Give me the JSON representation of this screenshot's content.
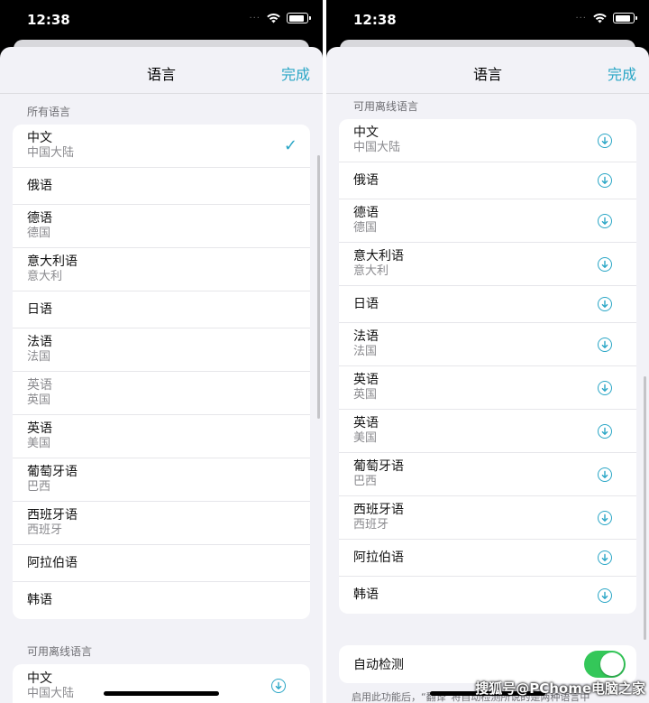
{
  "status": {
    "time": "12:38",
    "dots": "···"
  },
  "nav": {
    "title": "语言",
    "done": "完成"
  },
  "left": {
    "all_languages_header": "所有语言",
    "all_languages": [
      {
        "name": "中文",
        "region": "中国大陆",
        "selected": true
      },
      {
        "name": "俄语",
        "region": ""
      },
      {
        "name": "德语",
        "region": "德国"
      },
      {
        "name": "意大利语",
        "region": "意大利"
      },
      {
        "name": "日语",
        "region": ""
      },
      {
        "name": "法语",
        "region": "法国"
      },
      {
        "name": "英语",
        "region": "英国",
        "dimmed": true
      },
      {
        "name": "英语",
        "region": "美国"
      },
      {
        "name": "葡萄牙语",
        "region": "巴西"
      },
      {
        "name": "西班牙语",
        "region": "西班牙"
      },
      {
        "name": "阿拉伯语",
        "region": ""
      },
      {
        "name": "韩语",
        "region": ""
      }
    ],
    "offline_header": "可用离线语言",
    "offline_first": {
      "name": "中文",
      "region": "中国大陆"
    }
  },
  "right": {
    "offline_header": "可用离线语言",
    "offline_languages": [
      {
        "name": "中文",
        "region": "中国大陆"
      },
      {
        "name": "俄语",
        "region": ""
      },
      {
        "name": "德语",
        "region": "德国"
      },
      {
        "name": "意大利语",
        "region": "意大利"
      },
      {
        "name": "日语",
        "region": ""
      },
      {
        "name": "法语",
        "region": "法国"
      },
      {
        "name": "英语",
        "region": "英国"
      },
      {
        "name": "英语",
        "region": "美国"
      },
      {
        "name": "葡萄牙语",
        "region": "巴西"
      },
      {
        "name": "西班牙语",
        "region": "西班牙"
      },
      {
        "name": "阿拉伯语",
        "region": ""
      },
      {
        "name": "韩语",
        "region": ""
      }
    ],
    "auto_detect_label": "自动检测",
    "auto_detect_on": true,
    "footnote": "启用此功能后，“翻译”将自动检测所说的是两种语言中"
  },
  "watermark": "搜狐号@PChome电脑之家",
  "colors": {
    "accent": "#2aa6c6",
    "toggle_on": "#34c759",
    "background": "#f2f2f7"
  },
  "icons": {
    "selected": "checkmark-icon",
    "download": "download-circle-icon",
    "wifi": "wifi-icon",
    "battery": "battery-icon"
  }
}
